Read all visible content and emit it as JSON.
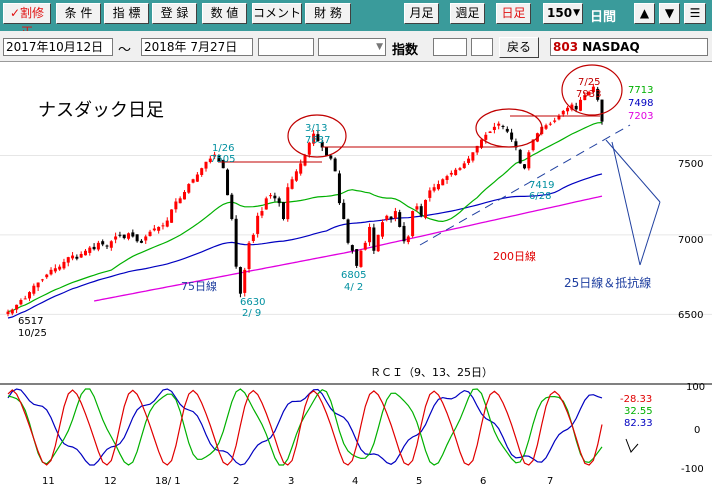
{
  "toolbar": {
    "buttons": [
      {
        "label": "割修正",
        "icon": "check-icon"
      },
      {
        "label": "条 件"
      },
      {
        "label": "指 標"
      },
      {
        "label": "登 録"
      },
      {
        "label": "数 値"
      },
      {
        "label": "コメント"
      },
      {
        "label": "財 務"
      }
    ],
    "period_buttons": [
      "月足",
      "週足",
      "日足"
    ],
    "active_period": "日足",
    "count_value": "150",
    "count_unit": "日間",
    "arrow_up": "▲",
    "arrow_down": "▼",
    "menu": "☰"
  },
  "infobar": {
    "start_date": "2017年10月12日",
    "range_sep": "～",
    "end_date": "2018年 7月27日",
    "index_label": "指数",
    "back_button": "戻る",
    "code": "803",
    "symbol": "NASDAQ"
  },
  "colors": {
    "up_candle": "#ff0000",
    "down_candle": "#000000",
    "ma25": "#00b000",
    "ma75": "#0000c0",
    "ma200": "#e000e0",
    "annotation": "#c00000",
    "cyan_label": "#0090a0",
    "blue_label": "#2040a0"
  },
  "chart_data": [
    {
      "type": "candlestick",
      "title": "ナスダック日足",
      "y_ticks": [
        7500,
        7000,
        6500
      ],
      "ylim": [
        6200,
        8000
      ],
      "x_ticks": [
        "11",
        "12",
        "18/ 1",
        "2",
        "3",
        "4",
        "5",
        "6",
        "7"
      ],
      "close_series": [
        6517,
        6530,
        6560,
        6590,
        6600,
        6640,
        6680,
        6700,
        6720,
        6750,
        6780,
        6790,
        6800,
        6830,
        6860,
        6870,
        6850,
        6880,
        6900,
        6920,
        6910,
        6950,
        6940,
        6930,
        6960,
        6990,
        7000,
        6980,
        7010,
        6990,
        6960,
        6950,
        6990,
        7020,
        7040,
        7050,
        7060,
        7090,
        7160,
        7210,
        7230,
        7270,
        7320,
        7350,
        7380,
        7420,
        7460,
        7480,
        7505,
        7460,
        7420,
        7250,
        7100,
        6800,
        6630,
        6780,
        6950,
        7000,
        7120,
        7150,
        7230,
        7250,
        7230,
        7200,
        7100,
        7300,
        7350,
        7400,
        7450,
        7500,
        7580,
        7637,
        7590,
        7550,
        7500,
        7480,
        7400,
        7200,
        7100,
        6950,
        6900,
        6805,
        6900,
        6950,
        7050,
        6900,
        7000,
        7080,
        7120,
        7100,
        7150,
        7050,
        6960,
        6990,
        7150,
        7180,
        7120,
        7220,
        7280,
        7300,
        7320,
        7350,
        7370,
        7390,
        7410,
        7420,
        7450,
        7480,
        7520,
        7560,
        7600,
        7630,
        7650,
        7680,
        7700,
        7680,
        7650,
        7600,
        7550,
        7450,
        7419,
        7520,
        7600,
        7640,
        7680,
        7690,
        7700,
        7720,
        7750,
        7780,
        7800,
        7820,
        7790,
        7850,
        7880,
        7900,
        7933,
        7850,
        7713
      ],
      "labels": [
        {
          "text": "6517",
          "color": "#000000"
        },
        {
          "text": "10/25",
          "color": "#000000"
        },
        {
          "text": "1/26",
          "color": "#0090a0"
        },
        {
          "text": "7505",
          "color": "#0090a0"
        },
        {
          "text": "6630",
          "color": "#0090a0"
        },
        {
          "text": "2/ 9",
          "color": "#0090a0"
        },
        {
          "text": "3/13",
          "color": "#0090a0"
        },
        {
          "text": "7637",
          "color": "#0090a0"
        },
        {
          "text": "6805",
          "color": "#0090a0"
        },
        {
          "text": "4/ 2",
          "color": "#0090a0"
        },
        {
          "text": "7419",
          "color": "#0090a0"
        },
        {
          "text": "6/28",
          "color": "#0090a0"
        },
        {
          "text": "7/25",
          "color": "#c00000"
        },
        {
          "text": "7933",
          "color": "#c00000"
        }
      ],
      "series": [
        {
          "name": "25日線",
          "current": "7713",
          "color": "#00b000"
        },
        {
          "name": "75日線",
          "current": "7498",
          "color": "#0000c0"
        },
        {
          "name": "200日線",
          "current": "7203",
          "color": "#e000e0"
        }
      ],
      "annotations": [
        "25日線＆抵抗線"
      ]
    },
    {
      "type": "line",
      "title": "ＲＣＩ（9、13、25日）",
      "y_ticks": [
        100,
        0,
        -100
      ],
      "ylim": [
        -100,
        100
      ],
      "series": [
        {
          "name": "9",
          "current": "-28.33",
          "color": "#e00000"
        },
        {
          "name": "13",
          "current": "32.55",
          "color": "#00b000"
        },
        {
          "name": "25",
          "current": "82.33",
          "color": "#0000c0"
        }
      ]
    }
  ]
}
